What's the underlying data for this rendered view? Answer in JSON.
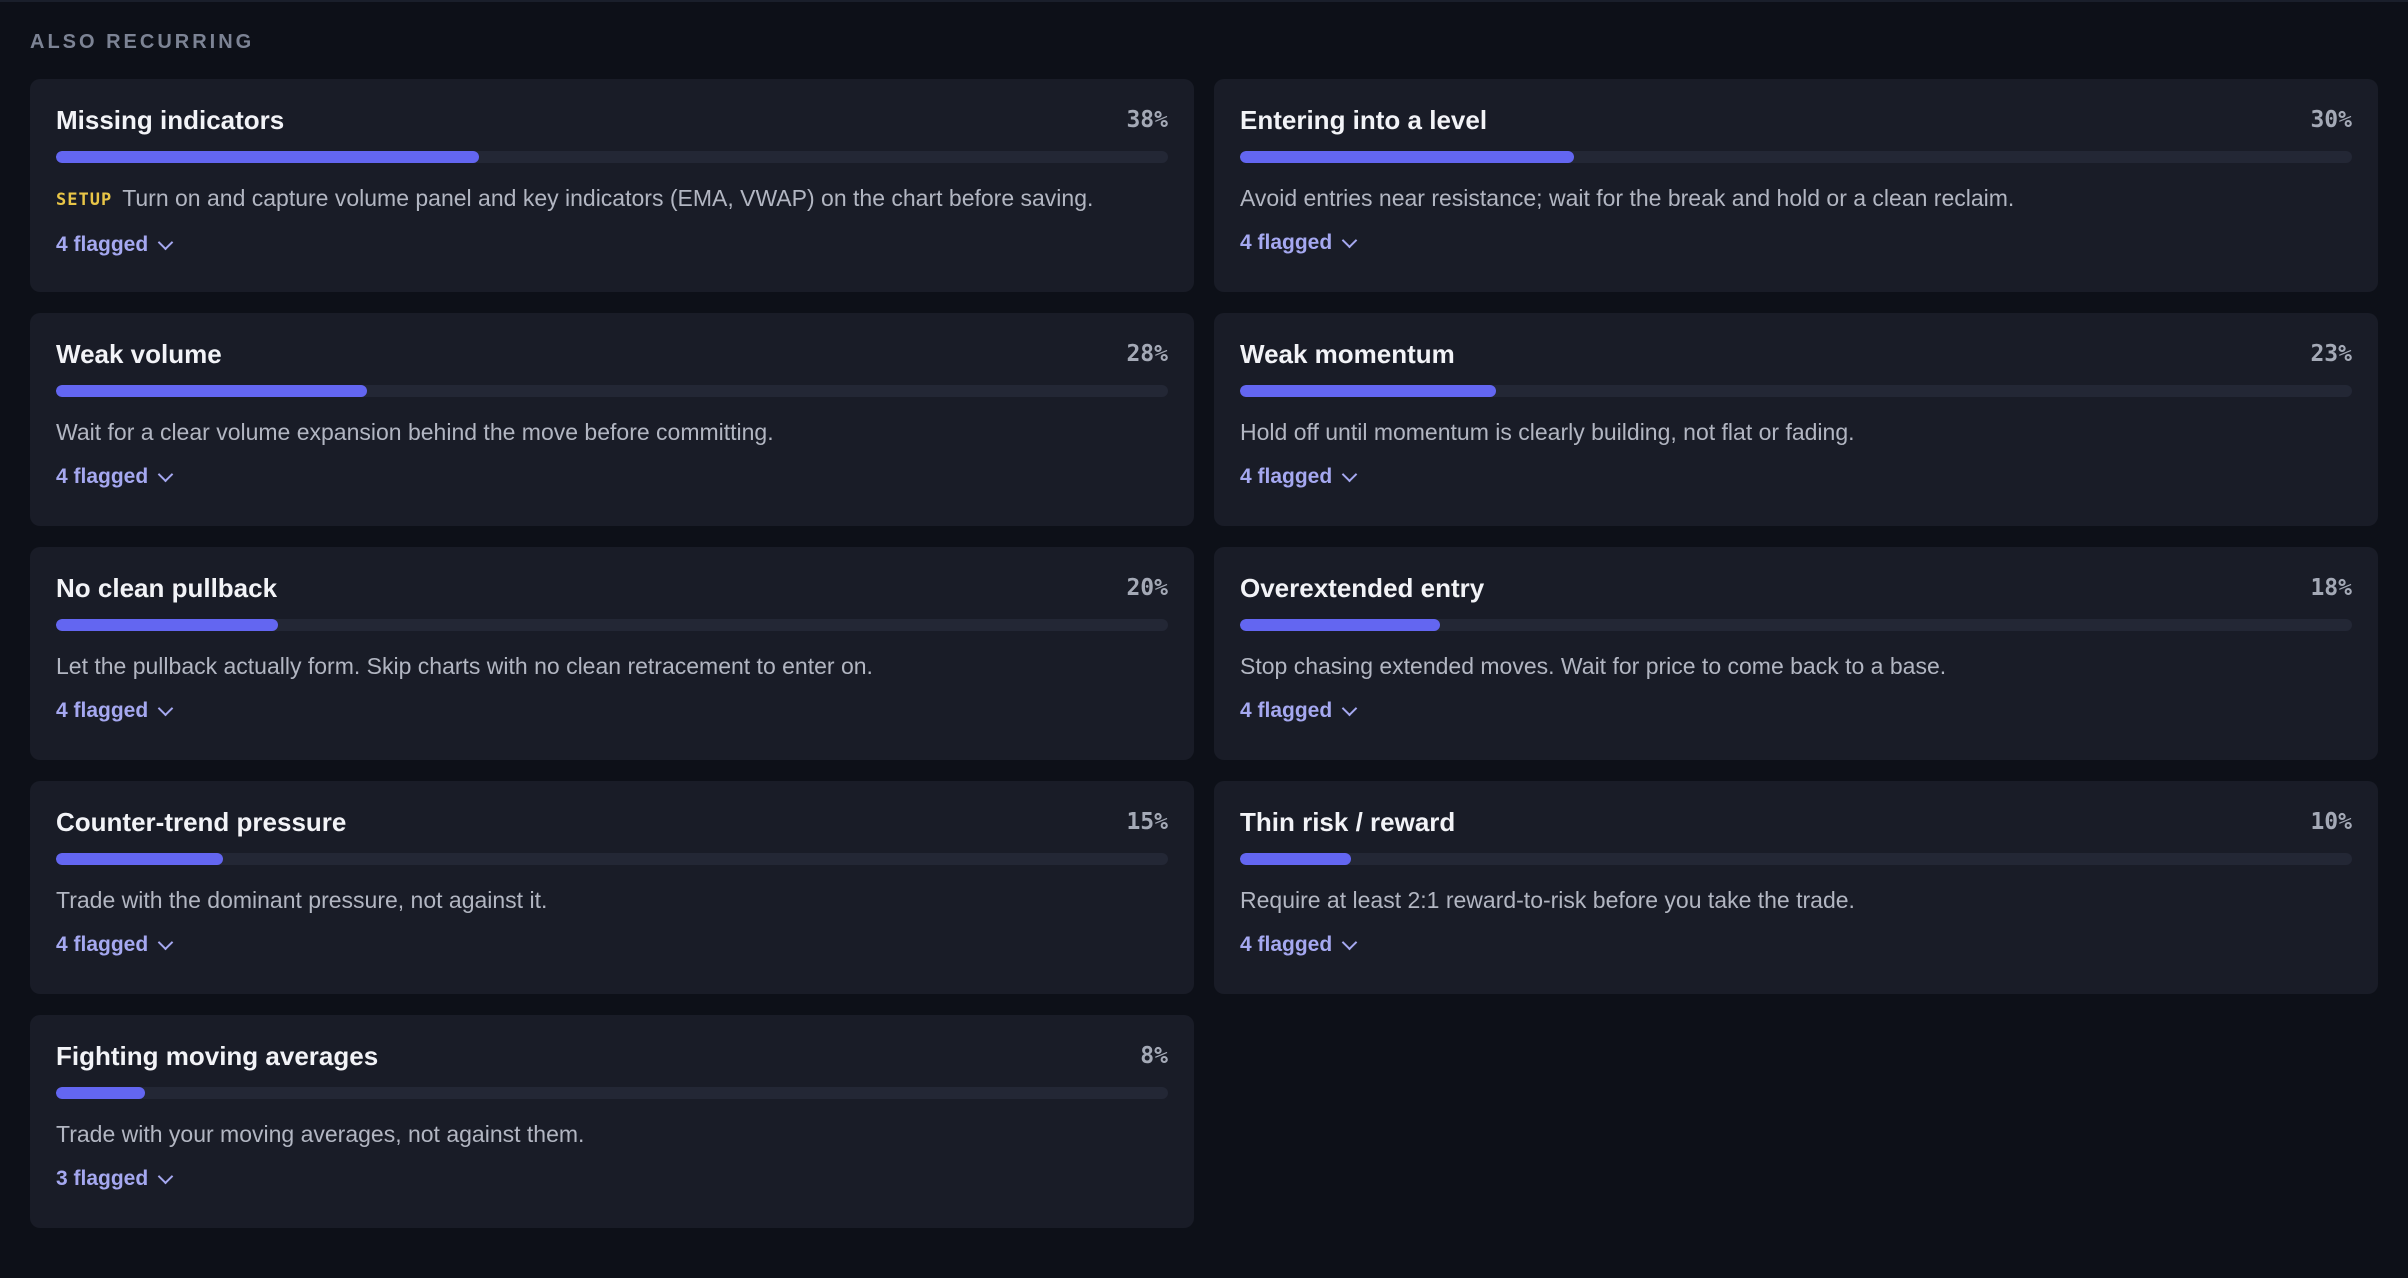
{
  "section": {
    "label": "ALSO RECURRING"
  },
  "colors": {
    "accent": "#6366f1",
    "tag": "#e8c547",
    "link": "#a5a8f0"
  },
  "cards": [
    {
      "title": "Missing indicators",
      "percent_label": "38%",
      "progress": 0.38,
      "tag": "SETUP",
      "description": "Turn on and capture volume panel and key indicators (EMA, VWAP) on the chart before saving.",
      "flagged": "4 flagged"
    },
    {
      "title": "Entering into a level",
      "percent_label": "30%",
      "progress": 0.3,
      "tag": "",
      "description": "Avoid entries near resistance; wait for the break and hold or a clean reclaim.",
      "flagged": "4 flagged"
    },
    {
      "title": "Weak volume",
      "percent_label": "28%",
      "progress": 0.28,
      "tag": "",
      "description": "Wait for a clear volume expansion behind the move before committing.",
      "flagged": "4 flagged"
    },
    {
      "title": "Weak momentum",
      "percent_label": "23%",
      "progress": 0.23,
      "tag": "",
      "description": "Hold off until momentum is clearly building, not flat or fading.",
      "flagged": "4 flagged"
    },
    {
      "title": "No clean pullback",
      "percent_label": "20%",
      "progress": 0.2,
      "tag": "",
      "description": "Let the pullback actually form. Skip charts with no clean retracement to enter on.",
      "flagged": "4 flagged"
    },
    {
      "title": "Overextended entry",
      "percent_label": "18%",
      "progress": 0.18,
      "tag": "",
      "description": "Stop chasing extended moves. Wait for price to come back to a base.",
      "flagged": "4 flagged"
    },
    {
      "title": "Counter-trend pressure",
      "percent_label": "15%",
      "progress": 0.15,
      "tag": "",
      "description": "Trade with the dominant pressure, not against it.",
      "flagged": "4 flagged"
    },
    {
      "title": "Thin risk / reward",
      "percent_label": "10%",
      "progress": 0.1,
      "tag": "",
      "description": "Require at least 2:1 reward-to-risk before you take the trade.",
      "flagged": "4 flagged"
    },
    {
      "title": "Fighting moving averages",
      "percent_label": "8%",
      "progress": 0.08,
      "tag": "",
      "description": "Trade with your moving averages, not against them.",
      "flagged": "3 flagged"
    }
  ]
}
